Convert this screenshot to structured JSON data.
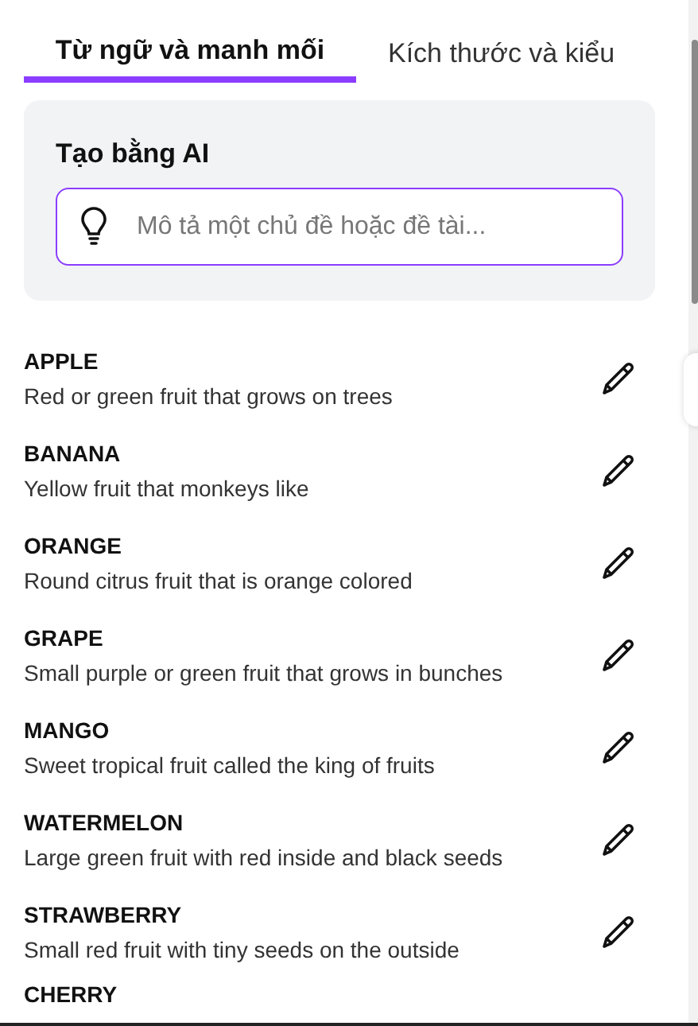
{
  "tabs": [
    {
      "label": "Từ ngữ và manh mối",
      "selected": true
    },
    {
      "label": "Kích thước và kiểu",
      "selected": false
    }
  ],
  "ai_panel": {
    "title": "Tạo bằng AI",
    "input": {
      "placeholder": "Mô tả một chủ đề hoặc đề tài..."
    }
  },
  "words": [
    {
      "word": "APPLE",
      "clue": "Red or green fruit that grows on trees"
    },
    {
      "word": "BANANA",
      "clue": "Yellow fruit that monkeys like"
    },
    {
      "word": "ORANGE",
      "clue": "Round citrus fruit that is orange colored"
    },
    {
      "word": "GRAPE",
      "clue": "Small purple or green fruit that grows in bunches"
    },
    {
      "word": "MANGO",
      "clue": "Sweet tropical fruit called the king of fruits"
    },
    {
      "word": "WATERMELON",
      "clue": "Large green fruit with red inside and black seeds"
    },
    {
      "word": "STRAWBERRY",
      "clue": "Small red fruit with tiny seeds on the outside"
    },
    {
      "word": "CHERRY"
    }
  ]
}
